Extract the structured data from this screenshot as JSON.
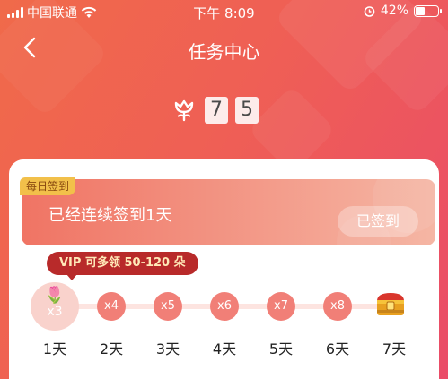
{
  "status_bar": {
    "carrier": "中国联通",
    "time": "下午 8:09",
    "battery": "42%",
    "battery_level": 0.42
  },
  "header": {
    "title": "任务中心",
    "points_digits": [
      "7",
      "5"
    ]
  },
  "checkin": {
    "tag": "每日签到",
    "message": "已经连续签到1天",
    "signed_button": "已签到",
    "vip_tip": "VIP 可多领 50-120 朵"
  },
  "days": [
    {
      "reward": "x3",
      "label": "1天"
    },
    {
      "reward": "x4",
      "label": "2天"
    },
    {
      "reward": "x5",
      "label": "3天"
    },
    {
      "reward": "x6",
      "label": "4天"
    },
    {
      "reward": "x7",
      "label": "5天"
    },
    {
      "reward": "x8",
      "label": "6天"
    },
    {
      "reward": "",
      "label": "7天"
    }
  ],
  "colors": {
    "accent": "#ef5f55",
    "vip_bg": "#b82a2a",
    "tag_bg": "#f2c04a"
  }
}
